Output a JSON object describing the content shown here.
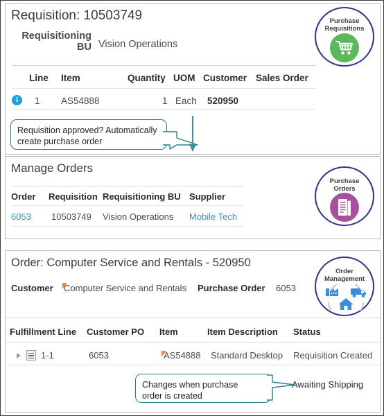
{
  "colors": {
    "badge_ring": "#2e3192",
    "green": "#5cb85c",
    "purple": "#a8509e",
    "blue_icon": "#3a8dde",
    "link": "#3f8fd2",
    "callout_border": "#2b7f8c",
    "orange_marker": "#f28b30",
    "info_blue": "#1da0e0"
  },
  "requisition_panel": {
    "title": "Requisition: 10503749",
    "bu_label": "Requisitioning BU",
    "bu_value": "Vision Operations",
    "badge": {
      "label_line1": "Purchase",
      "label_line2": "Requisitions",
      "icon": "shopping-cart-icon"
    },
    "table": {
      "headers": [
        "Line",
        "Item",
        "Quantity",
        "UOM",
        "Customer",
        "Sales Order"
      ],
      "rows": [
        {
          "info": "i",
          "line": "1",
          "item": "AS54888",
          "quantity": "1",
          "uom": "Each",
          "customer": "520950",
          "sales_order": ""
        }
      ]
    }
  },
  "callout_1": {
    "line1": "Requisition approved?  Automatically",
    "line2": "create purchase order"
  },
  "manage_orders_panel": {
    "title": "Manage Orders",
    "badge": {
      "label_line1": "Purchase",
      "label_line2": "Orders",
      "icon": "document-list-icon"
    },
    "table": {
      "headers": [
        "Order",
        "Requisition",
        "Requisitioning BU",
        "Supplier"
      ],
      "rows": [
        {
          "order": "6053",
          "requisition": "10503749",
          "requisitioning_bu": "Vision Operations",
          "supplier": "Mobile Tech"
        }
      ]
    }
  },
  "order_panel": {
    "title": "Order: Computer Service and Rentals - 520950",
    "customer_label": "Customer",
    "customer_value": "Computer Service and Rentals",
    "purchase_order_label": "Purchase Order",
    "purchase_order_value": "6053",
    "badge": {
      "label_line1": "Order",
      "label_line2": "Management",
      "icon": "order-management-icon"
    },
    "table": {
      "headers": [
        "Fulfillment Line",
        "Customer PO",
        "Item",
        "Item Description",
        "Status"
      ],
      "rows": [
        {
          "fulfillment_line": "1-1",
          "customer_po": "6053",
          "item": "AS54888",
          "item_description": "Standard Desktop",
          "status": "Requisition Created"
        }
      ]
    }
  },
  "callout_2": {
    "line1": "Changes when purchase",
    "line2": "order is created"
  },
  "awaiting_label": "Awaiting Shipping"
}
